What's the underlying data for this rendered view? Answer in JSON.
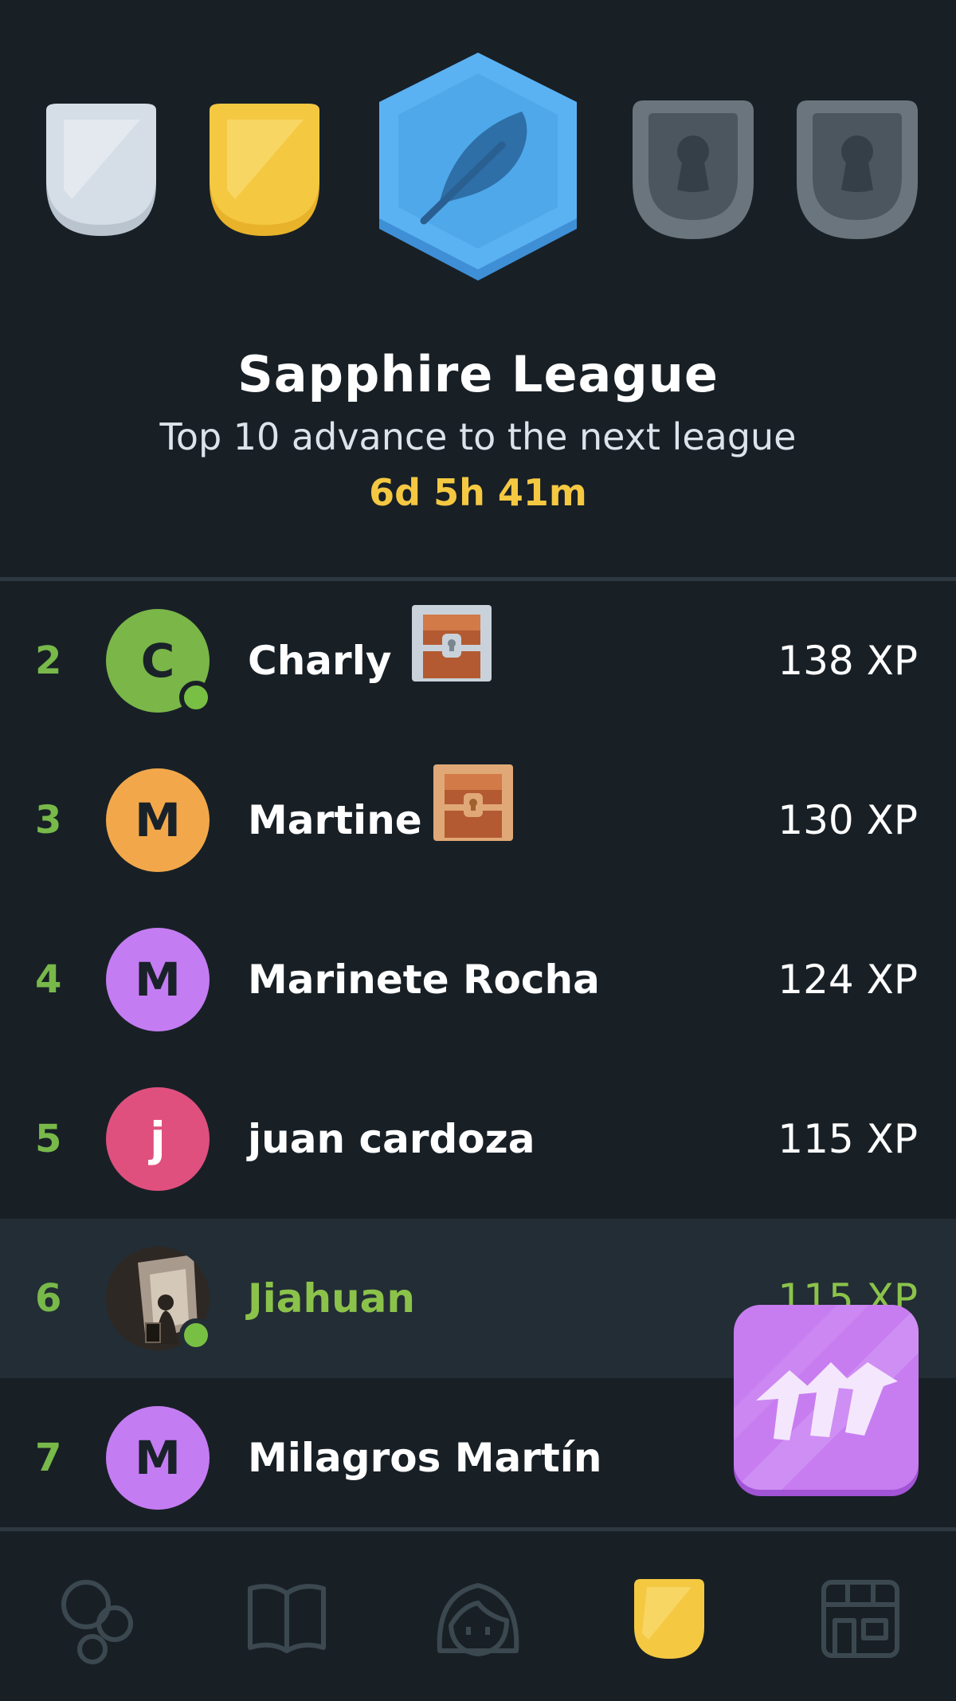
{
  "league": {
    "title": "Sapphire League",
    "subtitle": "Top 10 advance to the next league",
    "timer": "6d 5h 41m"
  },
  "badges": [
    {
      "name": "silver-league-badge",
      "color": "#d5dde6",
      "state": "completed"
    },
    {
      "name": "gold-league-badge",
      "color": "#f5c842",
      "state": "completed"
    },
    {
      "name": "sapphire-league-badge",
      "color": "#4fa8ea",
      "state": "current",
      "icon": "feather-icon"
    },
    {
      "name": "locked-league-badge",
      "color": "#4b565f",
      "state": "locked",
      "icon": "lock-icon"
    },
    {
      "name": "locked-league-badge",
      "color": "#4b565f",
      "state": "locked",
      "icon": "lock-icon"
    }
  ],
  "leaderboard": [
    {
      "rank": "2",
      "initial": "C",
      "name": "Charly",
      "xp": "138 XP",
      "avatar_color": "#7ab648",
      "online": true,
      "chest": "silver-chest-icon"
    },
    {
      "rank": "3",
      "initial": "M",
      "name": "Martine",
      "xp": "130 XP",
      "avatar_color": "#f2a84a",
      "online": false,
      "chest": "bronze-chest-icon"
    },
    {
      "rank": "4",
      "initial": "M",
      "name": "Marinete Rocha",
      "xp": "124 XP",
      "avatar_color": "#c47cf2",
      "online": false
    },
    {
      "rank": "5",
      "initial": "j",
      "name": "juan cardoza",
      "xp": "115 XP",
      "avatar_color": "#e0507e",
      "online": false
    },
    {
      "rank": "6",
      "initial": "",
      "name": "Jiahuan",
      "xp": "115 XP",
      "avatar_color": "#3a3430",
      "online": true,
      "current_user": true
    },
    {
      "rank": "7",
      "initial": "M",
      "name": "Milagros Martín",
      "xp": "",
      "avatar_color": "#c47cf2",
      "online": false
    }
  ],
  "tabs": [
    {
      "name": "tab-practice",
      "icon": "practice-circles-icon",
      "active": false
    },
    {
      "name": "tab-learn",
      "icon": "book-icon",
      "active": false
    },
    {
      "name": "tab-profile",
      "icon": "profile-face-icon",
      "active": false
    },
    {
      "name": "tab-leagues",
      "icon": "league-shield-icon",
      "active": true
    },
    {
      "name": "tab-shop",
      "icon": "shop-icon",
      "active": false
    }
  ],
  "colors": {
    "background": "#182026",
    "accent_green": "#78b94a",
    "timer_gold": "#f5c842",
    "fab_purple": "#c77df0"
  }
}
